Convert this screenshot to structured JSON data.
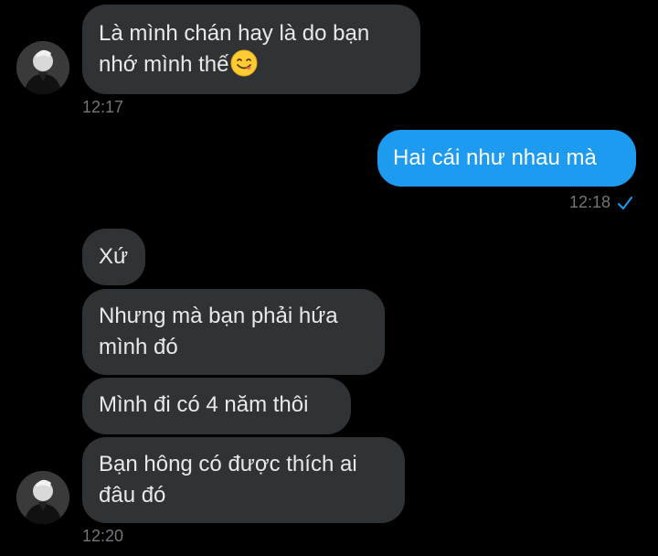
{
  "conversation": {
    "messages": [
      {
        "id": "m1",
        "direction": "incoming",
        "lines": [
          "Là mình chán hay là do bạn",
          "nhớ mình thế"
        ],
        "emoji": "savoring-face-emoji"
      },
      {
        "id": "m2",
        "direction": "outgoing",
        "text": "Hai cái như nhau mà"
      },
      {
        "id": "m3",
        "direction": "incoming",
        "text": "Xứ"
      },
      {
        "id": "m4",
        "direction": "incoming",
        "lines": [
          "Nhưng mà bạn phải hứa",
          "mình đó"
        ]
      },
      {
        "id": "m5",
        "direction": "incoming",
        "text": "Mình đi có 4 năm thôi"
      },
      {
        "id": "m6",
        "direction": "incoming",
        "lines": [
          "Bạn hông có được thích ai",
          "đâu đó"
        ]
      }
    ],
    "timestamps": {
      "t1": "12:17",
      "t2": "12:18",
      "t3": "12:20"
    },
    "read_receipt_icon": "check-icon"
  },
  "colors": {
    "background": "#000000",
    "incoming_bubble": "#2f3336",
    "outgoing_bubble": "#1d9bf0",
    "timestamp": "#71767b",
    "check": "#1d9bf0"
  }
}
